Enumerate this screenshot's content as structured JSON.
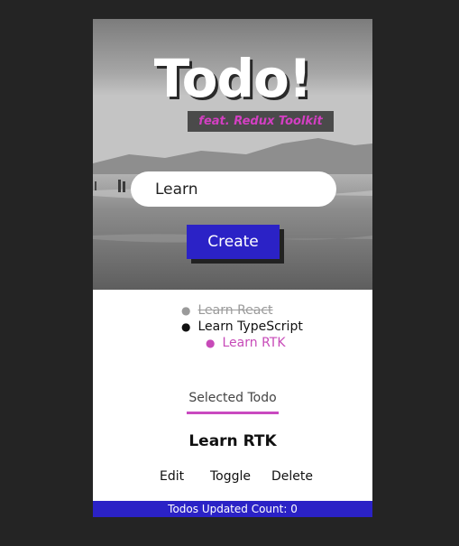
{
  "header": {
    "title": "Todo!",
    "subtitle": "feat. Redux Toolkit"
  },
  "form": {
    "input_value": "Learn",
    "create_label": "Create"
  },
  "todos": [
    {
      "text": "Learn React",
      "state": "done"
    },
    {
      "text": "Learn TypeScript",
      "state": "normal"
    },
    {
      "text": "Learn RTK",
      "state": "selected"
    }
  ],
  "selected": {
    "label": "Selected Todo",
    "name": "Learn RTK",
    "edit_label": "Edit",
    "toggle_label": "Toggle",
    "delete_label": "Delete"
  },
  "footer": {
    "counter_text": "Todos Updated Count: 0"
  },
  "colors": {
    "accent_blue": "#2b22c6",
    "accent_magenta": "#c94ac0",
    "page_background": "#242424"
  }
}
